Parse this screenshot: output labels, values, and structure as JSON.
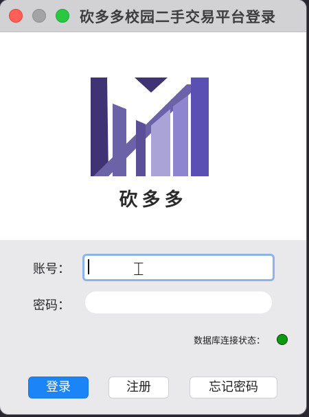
{
  "window": {
    "title": "砍多多校园二手交易平台登录"
  },
  "logo": {
    "brand_text": "砍多多"
  },
  "form": {
    "account_label": "账号：",
    "account_value": "",
    "password_label": "密码：",
    "password_value": ""
  },
  "status": {
    "label": "数据库连接状态：",
    "indicator_color": "#0c9a10"
  },
  "buttons": {
    "login": "登录",
    "register": "注册",
    "forgot_password": "忘记密码"
  },
  "colors": {
    "accent": "#1b84f7",
    "focus_ring": "#8db3ea",
    "logo_dark": "#3f3373",
    "logo_mid": "#6c62a8",
    "logo_light": "#a9a3d8"
  }
}
